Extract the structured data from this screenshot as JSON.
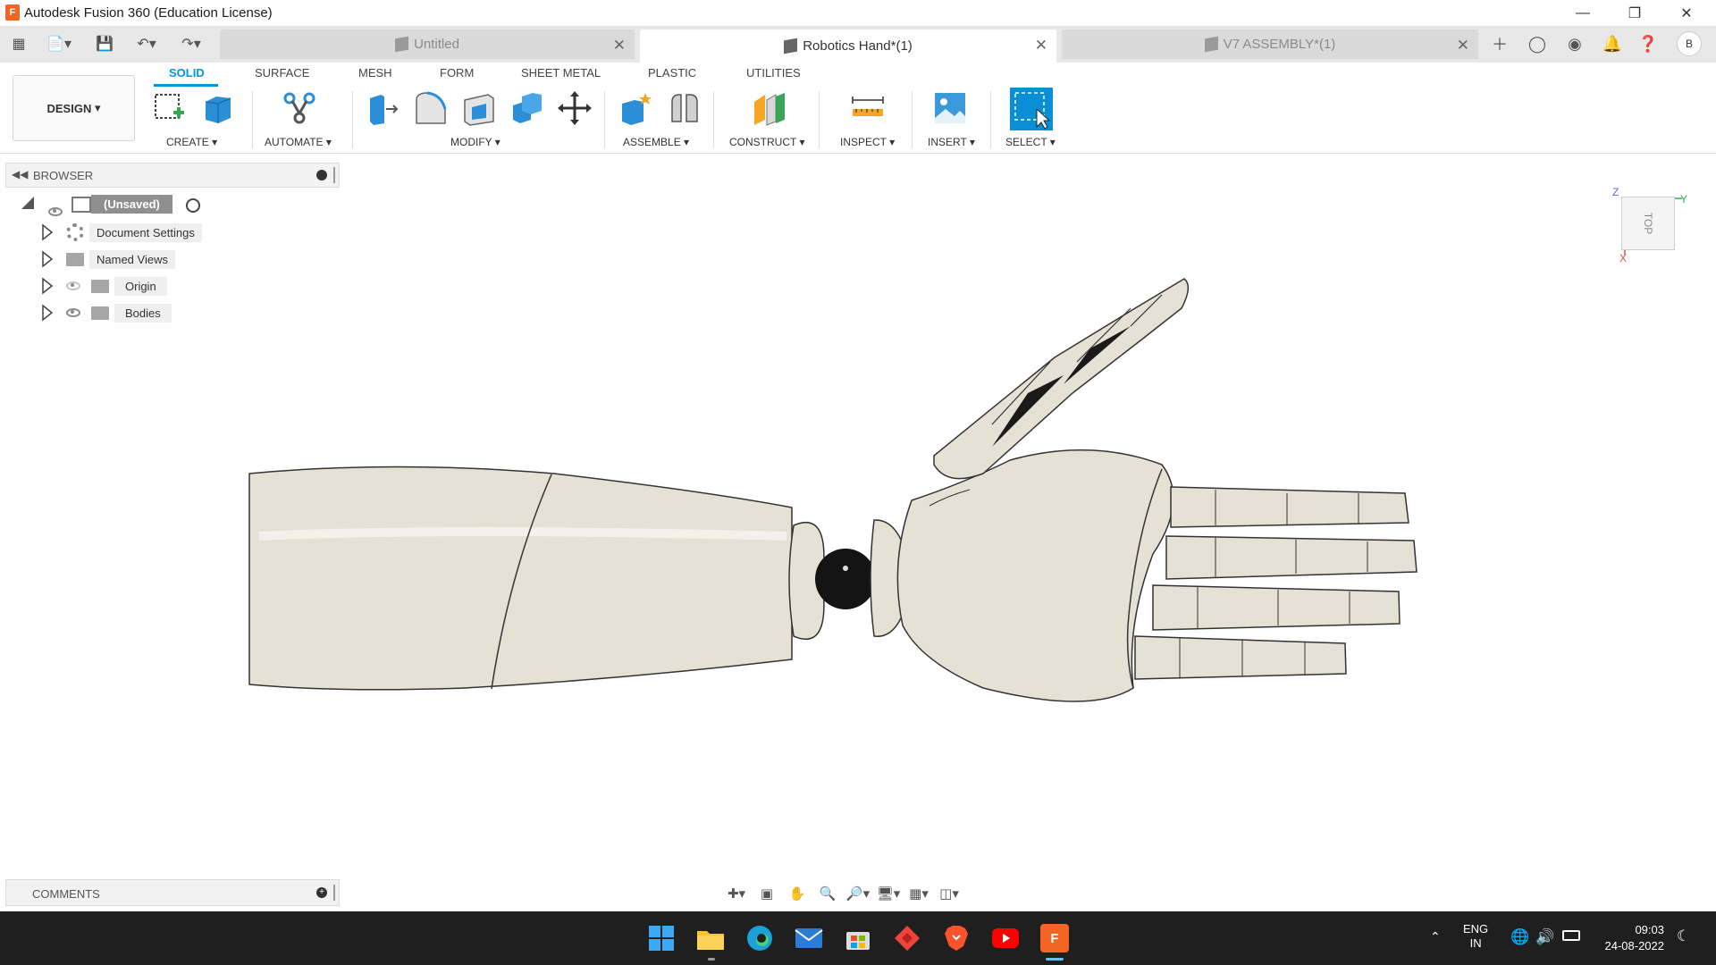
{
  "window": {
    "title": "Autodesk Fusion 360 (Education License)",
    "logo_letter": "F"
  },
  "tabs": [
    {
      "label": "Untitled"
    },
    {
      "label": "Robotics Hand*(1)"
    },
    {
      "label": "V7 ASSEMBLY*(1)"
    }
  ],
  "user": {
    "initial": "B"
  },
  "ribbon": {
    "workspace": "DESIGN",
    "tabs": [
      "SOLID",
      "SURFACE",
      "MESH",
      "FORM",
      "SHEET METAL",
      "PLASTIC",
      "UTILITIES"
    ],
    "groups": [
      "CREATE",
      "AUTOMATE",
      "MODIFY",
      "ASSEMBLE",
      "CONSTRUCT",
      "INSPECT",
      "INSERT",
      "SELECT"
    ]
  },
  "browser": {
    "title": "BROWSER",
    "root": "(Unsaved)",
    "items": [
      "Document Settings",
      "Named Views",
      "Origin",
      "Bodies"
    ]
  },
  "comments": {
    "title": "COMMENTS"
  },
  "viewcube": {
    "face": "TOP",
    "axis_z": "Z",
    "axis_y": "Y",
    "axis_x": "X"
  },
  "taskbar": {
    "lang_primary": "ENG",
    "lang_secondary": "IN",
    "time": "09:03",
    "date": "24-08-2022"
  },
  "colors": {
    "accent": "#0696d7",
    "model": "#e6e1d5",
    "taskbar": "#1f1f1f"
  }
}
